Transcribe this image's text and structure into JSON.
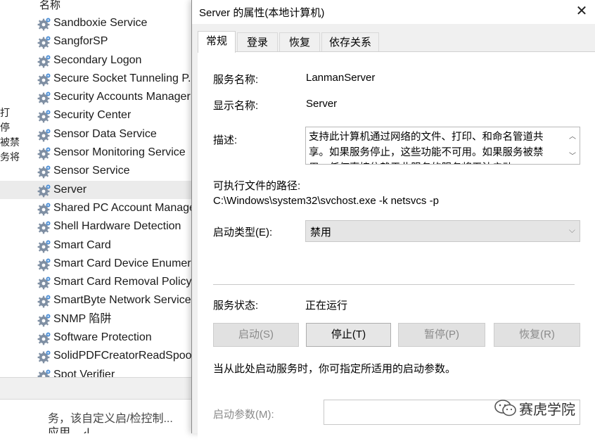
{
  "left_pane": {
    "column_header": "名称",
    "side_hint_lines": [
      "打",
      "停",
      "被禁",
      "务将"
    ],
    "services": [
      "Sandboxie Service",
      "SangforSP",
      "Secondary Logon",
      "Secure Socket Tunneling P...",
      "Security Accounts Manager",
      "Security Center",
      "Sensor Data Service",
      "Sensor Monitoring Service",
      "Sensor Service",
      "Server",
      "Shared PC Account Manager",
      "Shell Hardware Detection",
      "Smart Card",
      "Smart Card Device Enumer...",
      "Smart Card Removal Policy",
      "SmartByte Network Service",
      "SNMP 陷阱",
      "Software Protection",
      "SolidPDFCreatorReadSpool",
      "Spot Verifier"
    ],
    "selected_service": "Server",
    "bottom_text_line1": "务，该自定义启/检控制...",
    "bottom_text_line2": "应用。↲"
  },
  "dialog": {
    "title": "Server 的属性(本地计算机)",
    "close_glyph": "✕",
    "tabs": [
      "常规",
      "登录",
      "恢复",
      "依存关系"
    ],
    "active_tab": "常规",
    "general": {
      "service_name_label": "服务名称:",
      "service_name": "LanmanServer",
      "display_name_label": "显示名称:",
      "display_name": "Server",
      "description_label": "描述:",
      "description": "支持此计算机通过网络的文件、打印、和命名管道共享。如果服务停止，这些功能不可用。如果服务被禁用，任何直接依赖于此服务的服务将无法启动。",
      "exe_path_label": "可执行文件的路径:",
      "exe_path": "C:\\Windows\\system32\\svchost.exe -k netsvcs -p",
      "startup_type_label": "启动类型(E):",
      "startup_type": "禁用",
      "service_status_label": "服务状态:",
      "service_status": "正在运行",
      "buttons": {
        "start": "启动(S)",
        "stop": "停止(T)",
        "pause": "暂停(P)",
        "resume": "恢复(R)"
      },
      "hint_text": "当从此处启动服务时，你可指定所适用的启动参数。",
      "start_params_label": "启动参数(M):",
      "start_params_value": ""
    }
  },
  "watermark": {
    "text": "赛虎学院"
  }
}
